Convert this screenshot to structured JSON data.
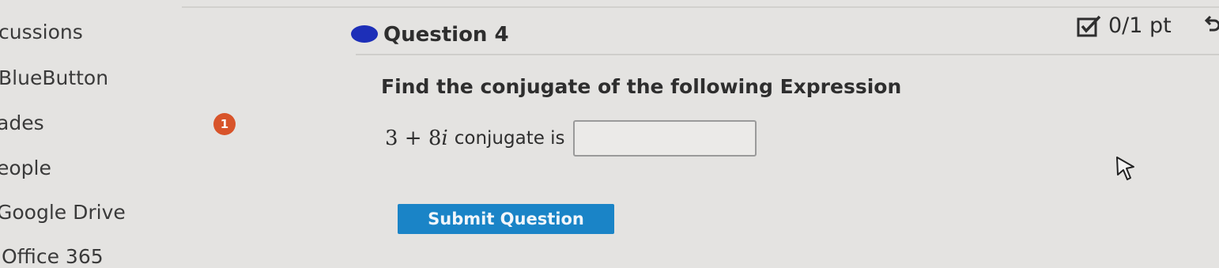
{
  "sidebar": {
    "items": [
      {
        "label": "cussions"
      },
      {
        "label": "BlueButton"
      },
      {
        "label": "ades"
      },
      {
        "label": "eople"
      },
      {
        "label": "Google Drive"
      },
      {
        "label": "Office 365"
      }
    ],
    "grades_badge": "1"
  },
  "question": {
    "title": "Question 4",
    "score": "0/1 pt",
    "prompt": "Find the conjugate of the following Expression",
    "expression_a": "3 + 8",
    "expression_i": "i",
    "conjugate_text": "conjugate is",
    "answer_value": "",
    "submit_label": "Submit Question"
  },
  "colors": {
    "badge": "#d8542a",
    "submit": "#1a84c7",
    "question_dot": "#1d2fb8"
  }
}
